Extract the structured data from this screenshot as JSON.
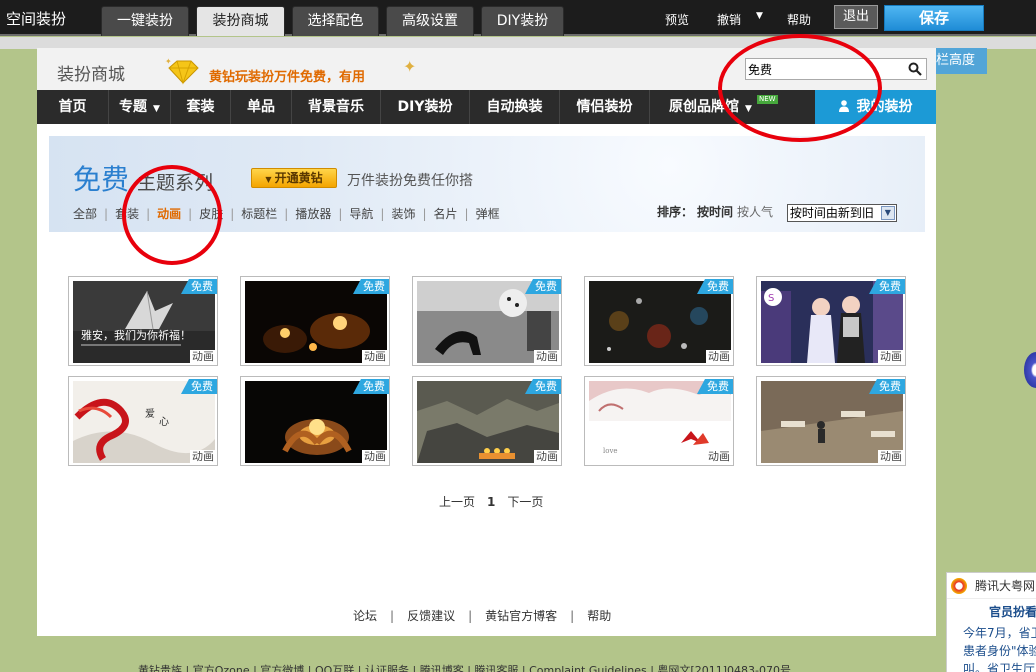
{
  "app_title": "空间装扮",
  "toolbar": {
    "tabs": [
      {
        "label": "一键装扮"
      },
      {
        "label": "装扮商城",
        "active": true
      },
      {
        "label": "选择配色"
      },
      {
        "label": "高级设置"
      },
      {
        "label": "DIY装扮"
      }
    ],
    "preview": "预览",
    "undo": "撤销",
    "help": "帮助",
    "exit": "退出",
    "save": "保存"
  },
  "background": {
    "column_height_label": "栏高度",
    "footer_links": "黄钻贵族 | 官方Qzone | 官方微博 | QQ互联 | 认证服务 | 腾讯博客 | 腾讯客服 | Complaint Guidelines | 粤网文[2011]0483-070号",
    "news_widget": {
      "source": "腾讯大粤网",
      "headline": "官员扮看",
      "lines": [
        "今年7月，省卫",
        "患者身份\"体验",
        "叫。省卫生厅"
      ]
    }
  },
  "mall": {
    "title": "装扮商城",
    "promo": "黄钻玩装扮万件免费，有用",
    "search": {
      "value": "免费",
      "placeholder": ""
    },
    "nav": [
      {
        "label": "首页"
      },
      {
        "label": "专题",
        "dropdown": true
      },
      {
        "label": "套装"
      },
      {
        "label": "单品"
      },
      {
        "label": "背景音乐"
      },
      {
        "label": "DIY装扮"
      },
      {
        "label": "自动换装"
      },
      {
        "label": "情侣装扮"
      },
      {
        "label": "原创品牌馆",
        "dropdown": true
      }
    ],
    "new_badge": "NEW",
    "my_dress": "我的装扮",
    "banner": {
      "title_free": "免费",
      "title_rest": "主题系列",
      "vip_button": "开通黄钻",
      "slogan": "万件装扮免费任你搭"
    },
    "categories": [
      {
        "label": "全部"
      },
      {
        "label": "套装"
      },
      {
        "label": "动画",
        "active": true
      },
      {
        "label": "皮肤"
      },
      {
        "label": "标题栏"
      },
      {
        "label": "播放器"
      },
      {
        "label": "导航"
      },
      {
        "label": "装饰"
      },
      {
        "label": "名片"
      },
      {
        "label": "弹框"
      }
    ],
    "sort": {
      "label": "排序：",
      "options": [
        {
          "label": "按时间",
          "active": true
        },
        {
          "label": "按人气"
        }
      ],
      "select_value": "按时间由新到旧"
    },
    "items": [
      {
        "tag": "免费",
        "kind": "动画",
        "thumb": "crane-prayer",
        "caption": "雅安，我们为你祈福！"
      },
      {
        "tag": "免费",
        "kind": "动画",
        "thumb": "candles-dark"
      },
      {
        "tag": "免费",
        "kind": "动画",
        "thumb": "heels-bw"
      },
      {
        "tag": "免费",
        "kind": "动画",
        "thumb": "rain-window"
      },
      {
        "tag": "免费",
        "kind": "动画",
        "thumb": "couple-city"
      },
      {
        "tag": "免费",
        "kind": "动画",
        "thumb": "red-ribbon"
      },
      {
        "tag": "免费",
        "kind": "动画",
        "thumb": "candle-hands"
      },
      {
        "tag": "免费",
        "kind": "动画",
        "thumb": "rubble-candles"
      },
      {
        "tag": "免费",
        "kind": "动画",
        "thumb": "snow-tree"
      },
      {
        "tag": "免费",
        "kind": "动画",
        "thumb": "cafe-tables"
      }
    ],
    "pager": {
      "prev": "上一页",
      "current": "1",
      "next": "下一页"
    },
    "footer": [
      "论坛",
      "反馈建议",
      "黄钻官方博客",
      "帮助"
    ]
  },
  "colors": {
    "accent_blue": "#1c9ad6",
    "orange_active": "#e06a00",
    "annotation_red": "#e8000c"
  }
}
